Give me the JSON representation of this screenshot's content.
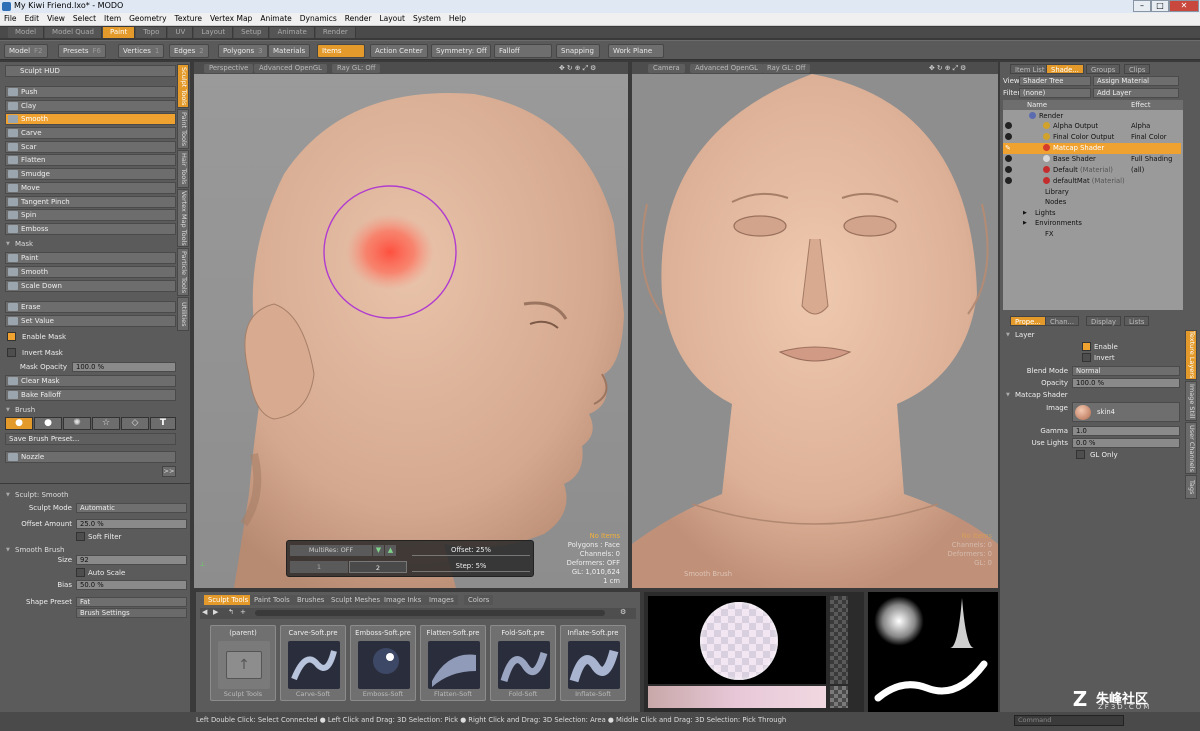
{
  "window": {
    "title": "My Kiwi Friend.lxo* - MODO",
    "min": "–",
    "max": "□",
    "close": "✕"
  },
  "menu": [
    "File",
    "Edit",
    "View",
    "Select",
    "Item",
    "Geometry",
    "Texture",
    "Vertex Map",
    "Animate",
    "Dynamics",
    "Render",
    "Layout",
    "System",
    "Help"
  ],
  "layout_tabs": [
    "Model",
    "Model Quad",
    "Paint",
    "Topo",
    "UV",
    "Layout",
    "Setup",
    "Animate",
    "Render"
  ],
  "active_layout_tab": "Paint",
  "toolbar": {
    "model": "Model",
    "model_key": "F2",
    "presets": "Presets",
    "presets_key": "F6",
    "vertices": "Vertices",
    "vertices_key": "1",
    "edges": "Edges",
    "edges_key": "2",
    "polygons": "Polygons",
    "polygons_key": "3",
    "materials": "Materials",
    "items": "Items",
    "action_center": "Action Center",
    "symmetry": "Symmetry: Off",
    "falloff": "Falloff",
    "snapping": "Snapping",
    "work_plane": "Work Plane"
  },
  "left": {
    "hud": "Sculpt HUD",
    "vtabs": [
      "Sculpt Tools",
      "Paint Tools",
      "Hair Tools",
      "Vertex Map Tools",
      "Particle Tools",
      "Utilities"
    ],
    "tools": [
      "Push",
      "Clay",
      "Smooth",
      "Carve",
      "Scar",
      "Flatten",
      "Smudge",
      "Move",
      "Tangent Pinch",
      "Spin",
      "Emboss"
    ],
    "active_tool": "Smooth",
    "mask_section": "Mask",
    "mask_tools": [
      "Paint",
      "Smooth",
      "Scale Down"
    ],
    "mask_tools2": [
      "Erase",
      "Set Value"
    ],
    "enable_mask": "Enable Mask",
    "invert_mask": "Invert Mask",
    "mask_opacity_label": "Mask Opacity",
    "mask_opacity": "100.0 %",
    "clear_mask": "Clear Mask",
    "bake_falloff": "Bake Falloff",
    "brush_section": "Brush",
    "save_brush": "Save Brush Preset...",
    "nozzle": "Nozzle",
    "expand": ">>",
    "sculpt_section": "Sculpt: Smooth",
    "sculpt_mode_label": "Sculpt Mode",
    "sculpt_mode": "Automatic",
    "offset_amount_label": "Offset Amount",
    "offset_amount": "25.0 %",
    "soft_filter": "Soft Filter",
    "smooth_brush_section": "Smooth Brush",
    "size_label": "Size",
    "size": "92",
    "auto_scale": "Auto Scale",
    "bias_label": "Bias",
    "bias": "50.0 %",
    "shape_preset_label": "Shape Preset",
    "shape_preset": "Fat",
    "brush_settings": "Brush Settings"
  },
  "viewport_left": {
    "tabs": [
      "Perspective",
      "Advanced OpenGL",
      "Ray GL: Off"
    ],
    "stats": {
      "items": "No Items",
      "polygons": "Polygons : Face",
      "channels": "Channels: 0",
      "deformers": "Deformers: OFF",
      "gl": "GL: 1,010,624",
      "scale": "1 cm"
    },
    "hud": {
      "multires": "MultiRes: OFF",
      "level1": "1",
      "level2": "2",
      "offset_label": "Offset:",
      "offset": "25%",
      "step_label": "Step:",
      "step": "5%"
    }
  },
  "viewport_right": {
    "tabs": [
      "Camera",
      "Advanced OpenGL",
      "Ray GL: Off"
    ],
    "stats": {
      "items": "No Items",
      "channels": "Channels: 0",
      "deformers": "Deformers: 0",
      "gl": "GL: 0"
    },
    "brush_label": "Smooth Brush"
  },
  "right": {
    "top_tabs": [
      "Item List",
      "Shade...",
      "Groups",
      "Clips"
    ],
    "view_label": "View",
    "view": "Shader Tree",
    "assign_material": "Assign Material",
    "filter_label": "Filter",
    "filter": "(none)",
    "add_layer": "Add Layer",
    "col_name": "Name",
    "col_effect": "Effect",
    "tree": [
      {
        "name": "Render",
        "effect": ""
      },
      {
        "name": "Alpha Output",
        "effect": "Alpha"
      },
      {
        "name": "Final Color Output",
        "effect": "Final Color"
      },
      {
        "name": "Matcap Shader",
        "effect": ""
      },
      {
        "name": "Base Shader",
        "effect": "Full Shading"
      },
      {
        "name": "Default",
        "tag": "(Material)",
        "effect": "(all)"
      },
      {
        "name": "defaultMat",
        "tag": "(Material)",
        "effect": ""
      },
      {
        "name": "Library",
        "effect": ""
      },
      {
        "name": "Nodes",
        "effect": ""
      },
      {
        "name": "Lights",
        "effect": ""
      },
      {
        "name": "Environments",
        "effect": ""
      },
      {
        "name": "FX",
        "effect": ""
      }
    ],
    "prop_tabs": [
      "Prope...",
      "Chan...",
      "Display",
      "Lists"
    ],
    "side_tabs": [
      "Texture Layers",
      "Image Still",
      "User Channels",
      "Tags"
    ],
    "layer_section": "Layer",
    "enable": "Enable",
    "invert": "Invert",
    "blend_label": "Blend Mode",
    "blend": "Normal",
    "opacity_label": "Opacity",
    "opacity": "100.0 %",
    "matcap_section": "Matcap Shader",
    "image_label": "Image",
    "image": "skin4",
    "gamma_label": "Gamma",
    "gamma": "1.0",
    "use_lights_label": "Use Lights",
    "use_lights": "0.0 %",
    "gl_only": "GL Only"
  },
  "bottom": {
    "tabs": [
      "Sculpt Tools",
      "Paint Tools",
      "Brushes",
      "Sculpt Meshes",
      "Image Inks",
      "Images",
      "Colors"
    ],
    "presets": [
      {
        "name": "(parent)",
        "foot": "Sculpt Tools"
      },
      {
        "name": "Carve-Soft.pre",
        "foot": "Carve-Soft"
      },
      {
        "name": "Emboss-Soft.pre",
        "foot": "Emboss-Soft"
      },
      {
        "name": "Flatten-Soft.pre",
        "foot": "Flatten-Soft"
      },
      {
        "name": "Fold-Soft.pre",
        "foot": "Fold-Soft"
      },
      {
        "name": "Inflate-Soft.pre",
        "foot": "Inflate-Soft"
      }
    ]
  },
  "status": "Left Double Click: Select Connected ● Left Click and Drag: 3D Selection: Pick ● Right Click and Drag: 3D Selection: Area ● Middle Click and Drag: 3D Selection: Pick Through",
  "command_placeholder": "Command",
  "watermark": {
    "cn": "朱峰社区",
    "url": "ZF3D.COM"
  }
}
